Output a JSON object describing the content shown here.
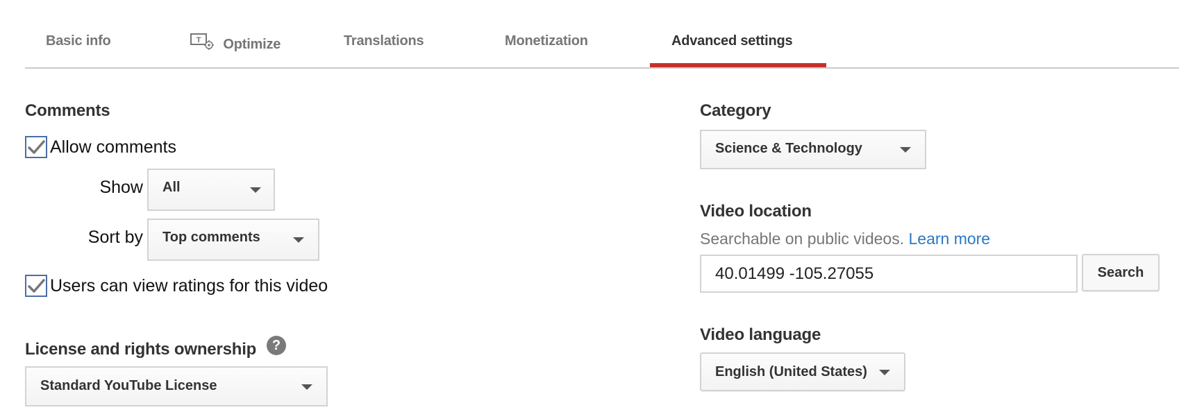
{
  "tabs": [
    {
      "label": "Basic info",
      "icon": null,
      "active": false
    },
    {
      "label": "Optimize",
      "icon": "text-gear-icon",
      "active": false
    },
    {
      "label": "Translations",
      "icon": null,
      "active": false
    },
    {
      "label": "Monetization",
      "icon": null,
      "active": false
    },
    {
      "label": "Advanced settings",
      "icon": null,
      "active": true
    }
  ],
  "colors": {
    "active_tab_underline": "#c4302b",
    "link": "#2a78c6",
    "checkbox_border": "#4a6ea5"
  },
  "comments": {
    "heading": "Comments",
    "allow_comments": {
      "label": "Allow comments",
      "checked": true
    },
    "show": {
      "label": "Show",
      "value": "All"
    },
    "sort_by": {
      "label": "Sort by",
      "value": "Top comments"
    },
    "view_ratings": {
      "label": "Users can view ratings for this video",
      "checked": true
    }
  },
  "license": {
    "heading": "License and rights ownership",
    "help_icon": "?",
    "value": "Standard YouTube License"
  },
  "category": {
    "heading": "Category",
    "value": "Science & Technology"
  },
  "video_location": {
    "heading": "Video location",
    "description": "Searchable on public videos.",
    "learn_more": "Learn more",
    "value": "40.01499 -105.27055",
    "search_button": "Search"
  },
  "video_language": {
    "heading": "Video language",
    "value": "English (United States)"
  }
}
